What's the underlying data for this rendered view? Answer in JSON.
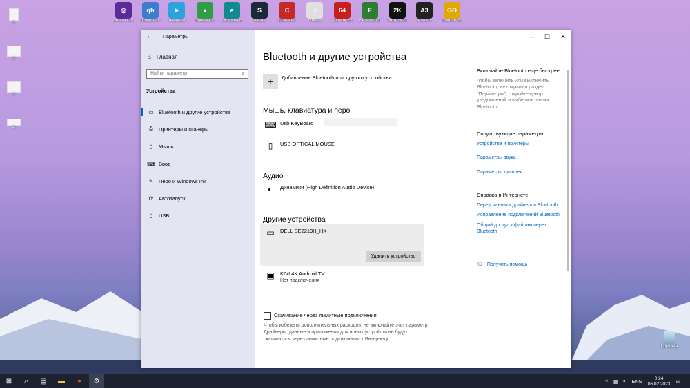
{
  "desktop": {
    "icons": [
      {
        "label": "Bonelli Connect",
        "color": "#5d2a9a",
        "glyph": "◎"
      },
      {
        "label": "qBittorrent",
        "color": "#3d7ccf",
        "glyph": "qb"
      },
      {
        "label": "Telegram",
        "color": "#2aa3df",
        "glyph": "➤"
      },
      {
        "label": "Google Chrome",
        "color": "#2f9e44",
        "glyph": "●"
      },
      {
        "label": "Microsoft Edge",
        "color": "#118a8f",
        "glyph": "e"
      },
      {
        "label": "Steam",
        "color": "#1b2838",
        "glyph": "S"
      },
      {
        "label": "CCleaner",
        "color": "#c62828",
        "glyph": "C"
      },
      {
        "label": "iTunes",
        "color": "#e0e0e0",
        "glyph": "♫"
      },
      {
        "label": "AIDA64 Extreme",
        "color": "#c81e1e",
        "glyph": "64"
      },
      {
        "label": "FPS Monitor",
        "color": "#2e7d32",
        "glyph": "F"
      },
      {
        "label": "NBA 2K21",
        "color": "#111111",
        "glyph": "2K"
      },
      {
        "label": "Arma 3",
        "color": "#222222",
        "glyph": "A3"
      },
      {
        "label": "Counter-Strike Global Off.",
        "color": "#e0a800",
        "glyph": "GO"
      }
    ],
    "side_icons": [
      "1",
      "2",
      "3",
      "4"
    ],
    "recycle_bin": "Корзина"
  },
  "window": {
    "title": "Параметры",
    "back_icon": "←",
    "minimize": "—",
    "maximize": "☐",
    "close": "✕"
  },
  "sidebar": {
    "home": "Главная",
    "search_placeholder": "Найти параметр",
    "section": "Устройства",
    "items": [
      {
        "label": "Bluetooth и другие устройства",
        "icon": "▭"
      },
      {
        "label": "Принтеры и сканеры",
        "icon": "⎙"
      },
      {
        "label": "Мышь",
        "icon": "▯"
      },
      {
        "label": "Ввод",
        "icon": "⌨"
      },
      {
        "label": "Перо и Windows Ink",
        "icon": "✎"
      },
      {
        "label": "Автозапуск",
        "icon": "⟳"
      },
      {
        "label": "USB",
        "icon": "▯"
      }
    ]
  },
  "main": {
    "title": "Bluetooth и другие устройства",
    "add_device": "Добавление Bluetooth или другого устройства",
    "sections": {
      "input": "Мышь, клавиатура и перо",
      "audio": "Аудио",
      "other": "Другие устройства"
    },
    "devices": {
      "keyboard": "Usb KeyBoard",
      "mouse": "USB OPTICAL MOUSE",
      "speakers": "Динамики (High Definition Audio Device)",
      "monitor": "DELL SE2219H_HX",
      "tv": "KIVI 4K Android TV",
      "tv_status": "Нет подключения"
    },
    "remove_button": "Удалить устройство",
    "metered_checkbox": "Скачивание через лимитные подключения",
    "metered_note": "Чтобы избежать дополнительных расходов, не включайте этот параметр. Драйверы, данные и приложения для новых устройств не будут скачиваться через лимитные подключения к Интернету."
  },
  "right": {
    "tip_title": "Включайте Bluetooth еще быстрее",
    "tip_text": "Чтобы включить или выключить Bluetooth, не открывая раздел \"Параметры\", откройте центр уведомлений и выберите значок Bluetooth.",
    "related_title": "Сопутствующие параметры",
    "related_links": [
      "Устройства и принтеры",
      "Параметры звука",
      "Параметры дисплея"
    ],
    "help_title": "Справка в Интернете",
    "help_links": [
      "Переустановка драйверов Bluetooth",
      "Исправление подключений Bluetooth",
      "Общий доступ к файлам через Bluetooth"
    ],
    "get_help": "Получить помощь"
  },
  "taskbar": {
    "lang": "ENG",
    "time": "0:24",
    "date": "06.02.2023"
  }
}
